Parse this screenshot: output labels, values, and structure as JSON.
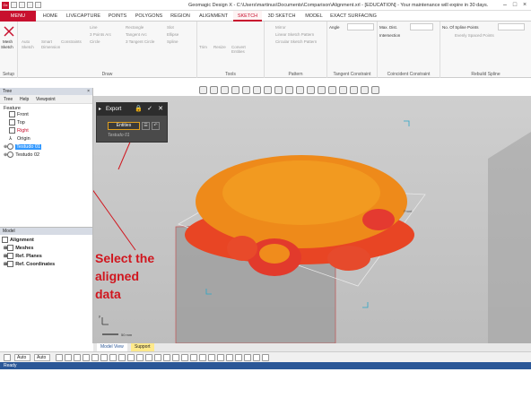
{
  "titlebar": {
    "app_icon": "Gx",
    "title": "Geomagic Design X - C:\\Users\\martinus\\Documents\\Comparison\\Alignment.xrl - [EDUCATION] - Your maintenance will expire in 30 days."
  },
  "ribbon_tabs": [
    "MENU",
    "HOME",
    "LIVECAPTURE",
    "POINTS",
    "POLYGONS",
    "REGION",
    "ALIGNMENT",
    "SKETCH",
    "3D SKETCH",
    "MODEL",
    "EXACT SURFACING"
  ],
  "ribbon": {
    "setup_label": "Setup",
    "setup_items": [
      "Mesh",
      "Sketch"
    ],
    "draw_label": "Draw",
    "draw_items": [
      "Auto",
      "Sketch",
      "Smart",
      "Dimension",
      "Constraints",
      "Line",
      "3 Points Arc",
      "Circle",
      "Rectangle",
      "Tangent Arc",
      "3 Tangent Circle",
      "Slot",
      "Ellipse",
      "Spline"
    ],
    "tools_label": "Tools",
    "tools_items": [
      "Trim",
      "Resize",
      "Convert Entities"
    ],
    "pattern_label": "Pattern",
    "pattern_items": [
      "Mirror",
      "Linear Sketch Pattern",
      "Circular Sketch Pattern"
    ],
    "tangent_label": "Tangent Constraint",
    "tangent_items": [
      "Angle"
    ],
    "coincident_label": "Coincident Constraint",
    "coincident_items": [
      "Max. Dist.",
      "Intersection"
    ],
    "rebuild_label": "Rebuild Spline",
    "rebuild_items": [
      "No. Of Spline Points",
      "Evenly Spaced Points"
    ]
  },
  "tree_panel": {
    "title": "Tree",
    "subtabs": [
      "Tree",
      "Help",
      "Viewpoint"
    ],
    "feature_label": "Feature",
    "items": [
      {
        "label": "Front",
        "color": "#222222"
      },
      {
        "label": "Top",
        "color": "#222222"
      },
      {
        "label": "Right",
        "color": "#c8102e"
      },
      {
        "label": "Origin",
        "color": "#222222"
      },
      {
        "label": "Testudo 01",
        "color": "#ffffff",
        "selected": true
      },
      {
        "label": "Testudo 02",
        "color": "#222222"
      }
    ]
  },
  "model_panel": {
    "title": "Model",
    "root": "Alignment",
    "items": [
      "Meshes",
      "Ref. Planes",
      "Ref. Coordinates"
    ]
  },
  "export_dialog": {
    "title": "Export",
    "entities_button": "Entities",
    "selected_part": "Testudo 01"
  },
  "annotation": {
    "line1": "Select the",
    "line2": "aligned",
    "line3": "data",
    "color": "#d0161e"
  },
  "viewport": {
    "scale_label": "50 mm",
    "plane_label": "Front"
  },
  "view_tabs": [
    "Model View",
    "Support"
  ],
  "bottom_dropdowns": [
    "Auto",
    "Auto"
  ],
  "status": "Ready"
}
